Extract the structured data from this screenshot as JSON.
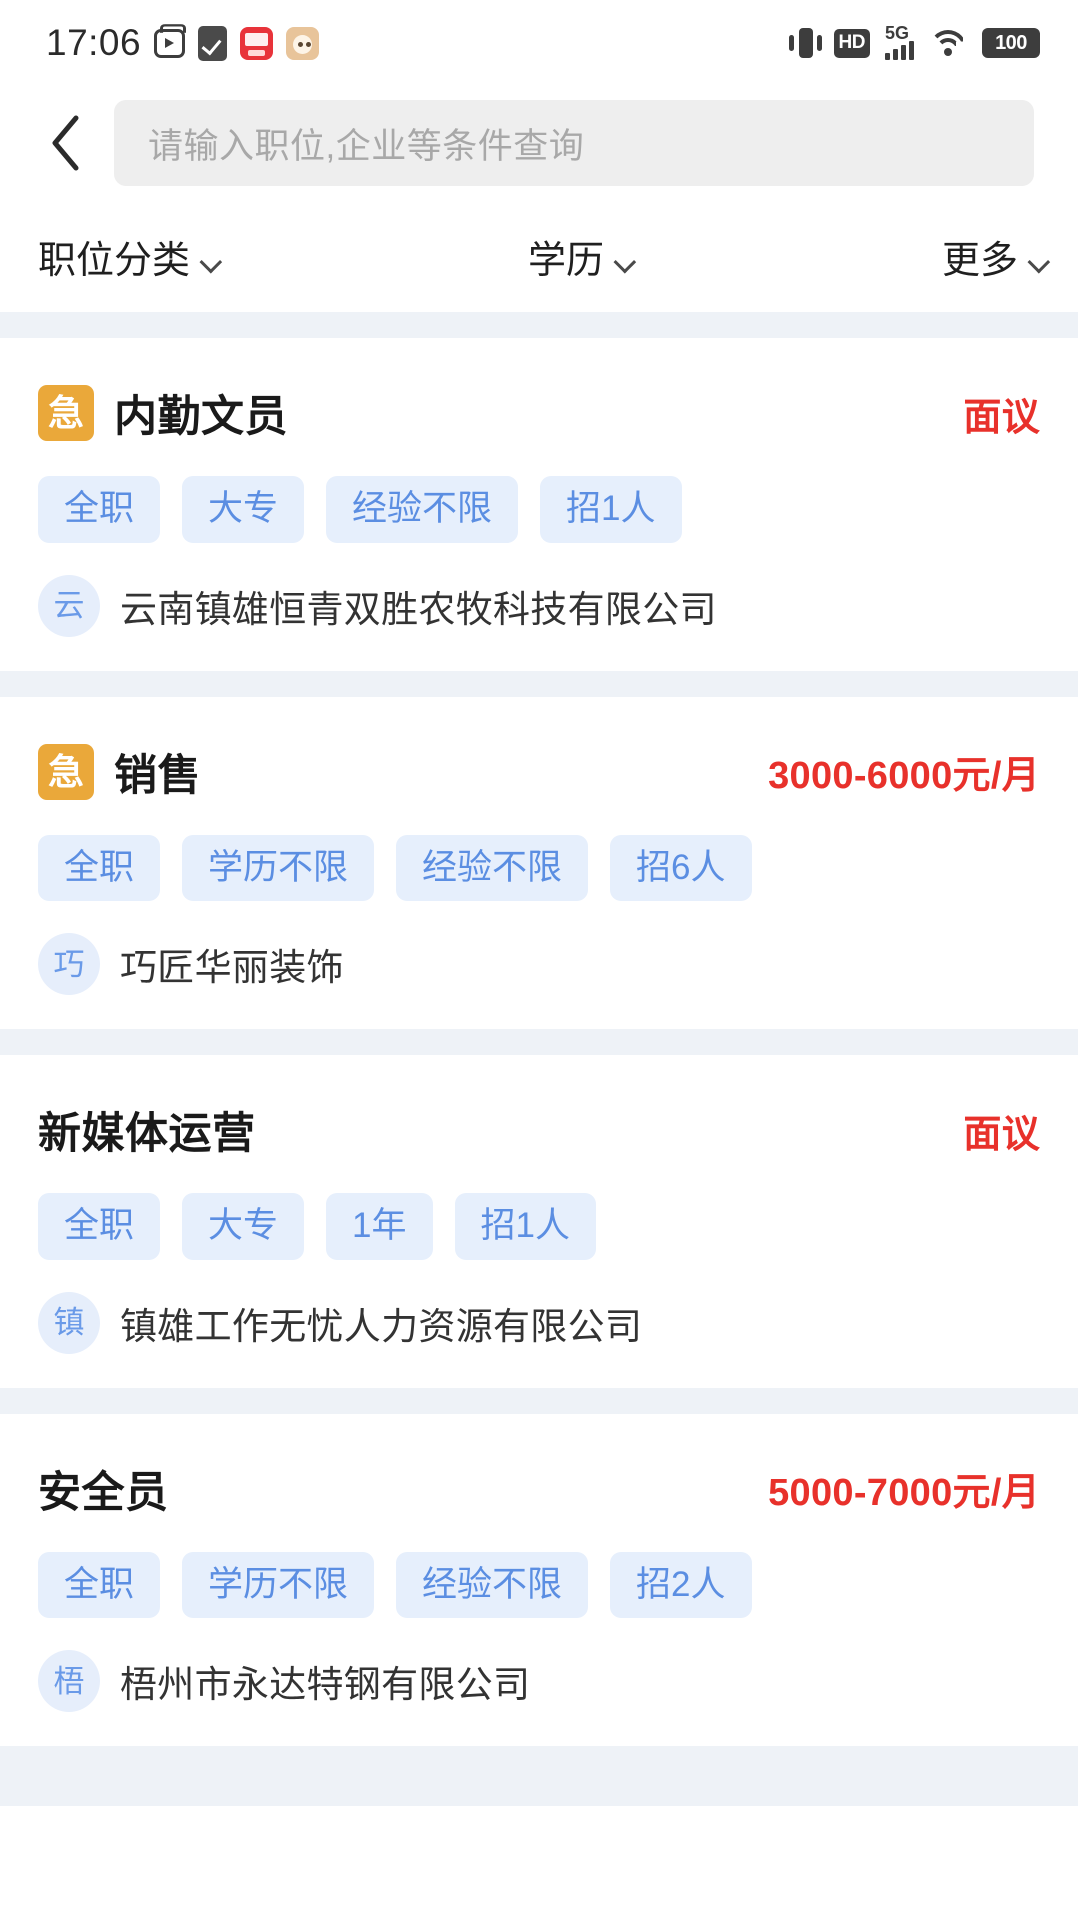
{
  "status_bar": {
    "time": "17:06",
    "left_icons": [
      "tv-app-icon",
      "check-clipboard-icon",
      "red-app-icon",
      "tan-app-icon"
    ],
    "vibrate_icon": "vibrate-icon",
    "hd_label": "HD",
    "network_label": "5G",
    "wifi_icon": "wifi-icon",
    "battery_label": "100"
  },
  "header": {
    "back_icon": "back-chevron-icon",
    "search_placeholder": "请输入职位,企业等条件查询"
  },
  "filters": [
    {
      "label": "职位分类",
      "icon": "chevron-down-icon"
    },
    {
      "label": "学历",
      "icon": "chevron-down-icon"
    },
    {
      "label": "更多",
      "icon": "chevron-down-icon"
    }
  ],
  "colors": {
    "urgent_badge": "#eaa83a",
    "salary_red": "#e8312b",
    "tag_bg": "#e6effc",
    "tag_text": "#5b8ee2",
    "page_bg": "#eef2f7"
  },
  "jobs": [
    {
      "urgent": true,
      "urgent_label": "急",
      "title": "内勤文员",
      "salary": "面议",
      "tags": [
        "全职",
        "大专",
        "经验不限",
        "招1人"
      ],
      "company_initial": "云",
      "company": "云南镇雄恒青双胜农牧科技有限公司"
    },
    {
      "urgent": true,
      "urgent_label": "急",
      "title": "销售",
      "salary": "3000-6000元/月",
      "tags": [
        "全职",
        "学历不限",
        "经验不限",
        "招6人"
      ],
      "company_initial": "巧",
      "company": "巧匠华丽装饰"
    },
    {
      "urgent": false,
      "urgent_label": "",
      "title": "新媒体运营",
      "salary": "面议",
      "tags": [
        "全职",
        "大专",
        "1年",
        "招1人"
      ],
      "company_initial": "镇",
      "company": "镇雄工作无忧人力资源有限公司"
    },
    {
      "urgent": false,
      "urgent_label": "",
      "title": "安全员",
      "salary": "5000-7000元/月",
      "tags": [
        "全职",
        "学历不限",
        "经验不限",
        "招2人"
      ],
      "company_initial": "梧",
      "company": "梧州市永达特钢有限公司"
    }
  ]
}
